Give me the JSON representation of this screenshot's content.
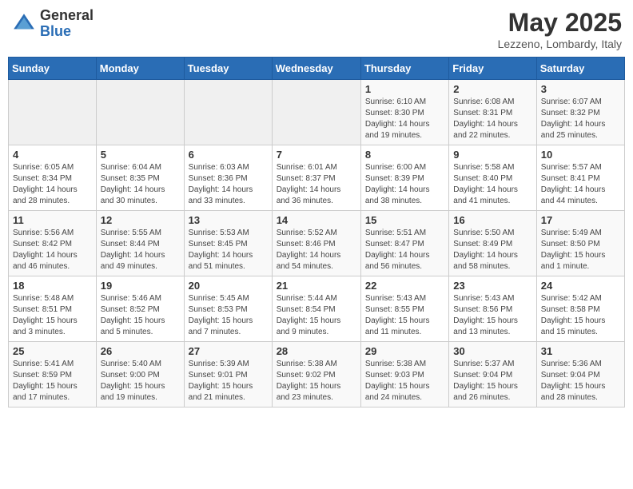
{
  "header": {
    "logo_general": "General",
    "logo_blue": "Blue",
    "month_title": "May 2025",
    "location": "Lezzeno, Lombardy, Italy"
  },
  "weekdays": [
    "Sunday",
    "Monday",
    "Tuesday",
    "Wednesday",
    "Thursday",
    "Friday",
    "Saturday"
  ],
  "weeks": [
    [
      {
        "day": "",
        "info": ""
      },
      {
        "day": "",
        "info": ""
      },
      {
        "day": "",
        "info": ""
      },
      {
        "day": "",
        "info": ""
      },
      {
        "day": "1",
        "info": "Sunrise: 6:10 AM\nSunset: 8:30 PM\nDaylight: 14 hours\nand 19 minutes."
      },
      {
        "day": "2",
        "info": "Sunrise: 6:08 AM\nSunset: 8:31 PM\nDaylight: 14 hours\nand 22 minutes."
      },
      {
        "day": "3",
        "info": "Sunrise: 6:07 AM\nSunset: 8:32 PM\nDaylight: 14 hours\nand 25 minutes."
      }
    ],
    [
      {
        "day": "4",
        "info": "Sunrise: 6:05 AM\nSunset: 8:34 PM\nDaylight: 14 hours\nand 28 minutes."
      },
      {
        "day": "5",
        "info": "Sunrise: 6:04 AM\nSunset: 8:35 PM\nDaylight: 14 hours\nand 30 minutes."
      },
      {
        "day": "6",
        "info": "Sunrise: 6:03 AM\nSunset: 8:36 PM\nDaylight: 14 hours\nand 33 minutes."
      },
      {
        "day": "7",
        "info": "Sunrise: 6:01 AM\nSunset: 8:37 PM\nDaylight: 14 hours\nand 36 minutes."
      },
      {
        "day": "8",
        "info": "Sunrise: 6:00 AM\nSunset: 8:39 PM\nDaylight: 14 hours\nand 38 minutes."
      },
      {
        "day": "9",
        "info": "Sunrise: 5:58 AM\nSunset: 8:40 PM\nDaylight: 14 hours\nand 41 minutes."
      },
      {
        "day": "10",
        "info": "Sunrise: 5:57 AM\nSunset: 8:41 PM\nDaylight: 14 hours\nand 44 minutes."
      }
    ],
    [
      {
        "day": "11",
        "info": "Sunrise: 5:56 AM\nSunset: 8:42 PM\nDaylight: 14 hours\nand 46 minutes."
      },
      {
        "day": "12",
        "info": "Sunrise: 5:55 AM\nSunset: 8:44 PM\nDaylight: 14 hours\nand 49 minutes."
      },
      {
        "day": "13",
        "info": "Sunrise: 5:53 AM\nSunset: 8:45 PM\nDaylight: 14 hours\nand 51 minutes."
      },
      {
        "day": "14",
        "info": "Sunrise: 5:52 AM\nSunset: 8:46 PM\nDaylight: 14 hours\nand 54 minutes."
      },
      {
        "day": "15",
        "info": "Sunrise: 5:51 AM\nSunset: 8:47 PM\nDaylight: 14 hours\nand 56 minutes."
      },
      {
        "day": "16",
        "info": "Sunrise: 5:50 AM\nSunset: 8:49 PM\nDaylight: 14 hours\nand 58 minutes."
      },
      {
        "day": "17",
        "info": "Sunrise: 5:49 AM\nSunset: 8:50 PM\nDaylight: 15 hours\nand 1 minute."
      }
    ],
    [
      {
        "day": "18",
        "info": "Sunrise: 5:48 AM\nSunset: 8:51 PM\nDaylight: 15 hours\nand 3 minutes."
      },
      {
        "day": "19",
        "info": "Sunrise: 5:46 AM\nSunset: 8:52 PM\nDaylight: 15 hours\nand 5 minutes."
      },
      {
        "day": "20",
        "info": "Sunrise: 5:45 AM\nSunset: 8:53 PM\nDaylight: 15 hours\nand 7 minutes."
      },
      {
        "day": "21",
        "info": "Sunrise: 5:44 AM\nSunset: 8:54 PM\nDaylight: 15 hours\nand 9 minutes."
      },
      {
        "day": "22",
        "info": "Sunrise: 5:43 AM\nSunset: 8:55 PM\nDaylight: 15 hours\nand 11 minutes."
      },
      {
        "day": "23",
        "info": "Sunrise: 5:43 AM\nSunset: 8:56 PM\nDaylight: 15 hours\nand 13 minutes."
      },
      {
        "day": "24",
        "info": "Sunrise: 5:42 AM\nSunset: 8:58 PM\nDaylight: 15 hours\nand 15 minutes."
      }
    ],
    [
      {
        "day": "25",
        "info": "Sunrise: 5:41 AM\nSunset: 8:59 PM\nDaylight: 15 hours\nand 17 minutes."
      },
      {
        "day": "26",
        "info": "Sunrise: 5:40 AM\nSunset: 9:00 PM\nDaylight: 15 hours\nand 19 minutes."
      },
      {
        "day": "27",
        "info": "Sunrise: 5:39 AM\nSunset: 9:01 PM\nDaylight: 15 hours\nand 21 minutes."
      },
      {
        "day": "28",
        "info": "Sunrise: 5:38 AM\nSunset: 9:02 PM\nDaylight: 15 hours\nand 23 minutes."
      },
      {
        "day": "29",
        "info": "Sunrise: 5:38 AM\nSunset: 9:03 PM\nDaylight: 15 hours\nand 24 minutes."
      },
      {
        "day": "30",
        "info": "Sunrise: 5:37 AM\nSunset: 9:04 PM\nDaylight: 15 hours\nand 26 minutes."
      },
      {
        "day": "31",
        "info": "Sunrise: 5:36 AM\nSunset: 9:04 PM\nDaylight: 15 hours\nand 28 minutes."
      }
    ]
  ]
}
